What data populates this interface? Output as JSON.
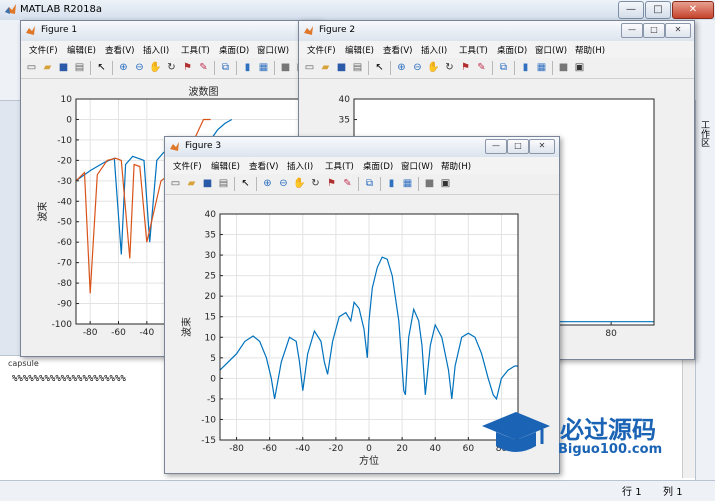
{
  "matlab": {
    "title": "MATLAB R2018a",
    "window_controls": [
      "—",
      "□",
      "✕"
    ],
    "cmd_label": "capsule",
    "command_output": "%%%%%%%%%%%%%%%%%%%%%",
    "workspace_tab": "工作区",
    "status": {
      "row_label": "行",
      "row_value": "1",
      "col_label": "列",
      "col_value": "1"
    }
  },
  "figure1": {
    "title": "Figure 1",
    "menu": [
      "文件(F)",
      "编辑(E)",
      "查看(V)",
      "插入(I)",
      "工具(T)",
      "桌面(D)",
      "窗口(W)"
    ]
  },
  "figure2": {
    "title": "Figure 2",
    "menu": [
      "文件(F)",
      "编辑(E)",
      "查看(V)",
      "插入(I)",
      "工具(T)",
      "桌面(D)",
      "窗口(W)",
      "帮助(H)"
    ]
  },
  "figure3": {
    "title": "Figure 3",
    "menu": [
      "文件(F)",
      "编辑(E)",
      "查看(V)",
      "插入(I)",
      "工具(T)",
      "桌面(D)",
      "窗口(W)",
      "帮助(H)"
    ]
  },
  "watermark": {
    "brand": "必过源码",
    "site": "Biguo100.com"
  },
  "chart_data": [
    {
      "type": "line",
      "title": "波数图",
      "xlabel": "",
      "ylabel": "波束",
      "xlim": [
        -90,
        90
      ],
      "ylim": [
        -100,
        10
      ],
      "x_ticks": [
        -80,
        -60,
        -40
      ],
      "y_ticks": [
        10,
        0,
        -10,
        -20,
        -30,
        -40,
        -50,
        -60,
        -70,
        -80,
        -90,
        -100
      ],
      "grid": true,
      "series": [
        {
          "color": "#0072bd",
          "x": [
            -90,
            -80,
            -70,
            -63,
            -58,
            -55,
            -50,
            -42,
            -38,
            -33,
            -28,
            -20,
            -10,
            0,
            5,
            10,
            15,
            20
          ],
          "y": [
            -30,
            -25,
            -21,
            -19,
            -66,
            -22,
            -18,
            -20,
            -60,
            -20,
            -16,
            -14,
            -13,
            -12,
            -10,
            -5,
            -2,
            0
          ]
        },
        {
          "color": "#d95319",
          "x": [
            -90,
            -84,
            -80,
            -75,
            -68,
            -62,
            -58,
            -52,
            -49,
            -45,
            -40,
            -30,
            -20,
            -10,
            0,
            5
          ],
          "y": [
            -30,
            -26,
            -85,
            -27,
            -20,
            -19,
            -20,
            -68,
            -22,
            -23,
            -60,
            -30,
            -25,
            -15,
            0,
            0
          ]
        }
      ]
    },
    {
      "type": "line",
      "title": "",
      "xlabel": "",
      "ylabel": "",
      "xlim": [
        20,
        90
      ],
      "ylim": [
        -15,
        40
      ],
      "x_ticks": [
        40,
        60,
        80
      ],
      "y_ticks": [
        40,
        35,
        30
      ],
      "grid": false,
      "series": [
        {
          "color": "#0072bd",
          "x": [
            30,
            90
          ],
          "y": [
            -14.2,
            -14.2
          ]
        }
      ]
    },
    {
      "type": "line",
      "title": "",
      "xlabel": "方位",
      "ylabel": "波束",
      "xlim": [
        -90,
        90
      ],
      "ylim": [
        -15,
        40
      ],
      "x_ticks": [
        -80,
        -60,
        -40,
        -20,
        0,
        20,
        40,
        60,
        80
      ],
      "y_ticks": [
        40,
        35,
        30,
        25,
        20,
        15,
        10,
        5,
        0,
        -5,
        -10,
        -15
      ],
      "grid": true,
      "series": [
        {
          "color": "#0072bd",
          "x": [
            -90,
            -80,
            -75,
            -70,
            -66,
            -62,
            -59,
            -57,
            -53,
            -48,
            -44,
            -42,
            -40,
            -37,
            -33,
            -29,
            -27,
            -25,
            -22,
            -18,
            -14,
            -11,
            -9,
            -6,
            -3,
            -1,
            0,
            2,
            5,
            8,
            11,
            14,
            18,
            21,
            22,
            24,
            27,
            30,
            32,
            34,
            37,
            40,
            44,
            48,
            50,
            52,
            56,
            60,
            64,
            68,
            72,
            75,
            77,
            80,
            84,
            88,
            90
          ],
          "y": [
            2,
            6,
            9,
            10.3,
            9,
            5,
            0,
            -5,
            4,
            10,
            9,
            4,
            -3,
            6,
            11.5,
            9,
            4,
            1,
            9,
            15,
            16,
            14,
            18.5,
            17,
            12,
            5,
            14,
            22,
            27,
            29.5,
            29,
            25,
            14,
            -3,
            -4,
            10,
            16.8,
            14,
            8,
            -4,
            8,
            13,
            10,
            2,
            -5,
            3,
            10,
            11,
            10,
            6,
            0,
            -4,
            -5,
            0,
            2,
            3,
            3
          ]
        }
      ]
    }
  ]
}
